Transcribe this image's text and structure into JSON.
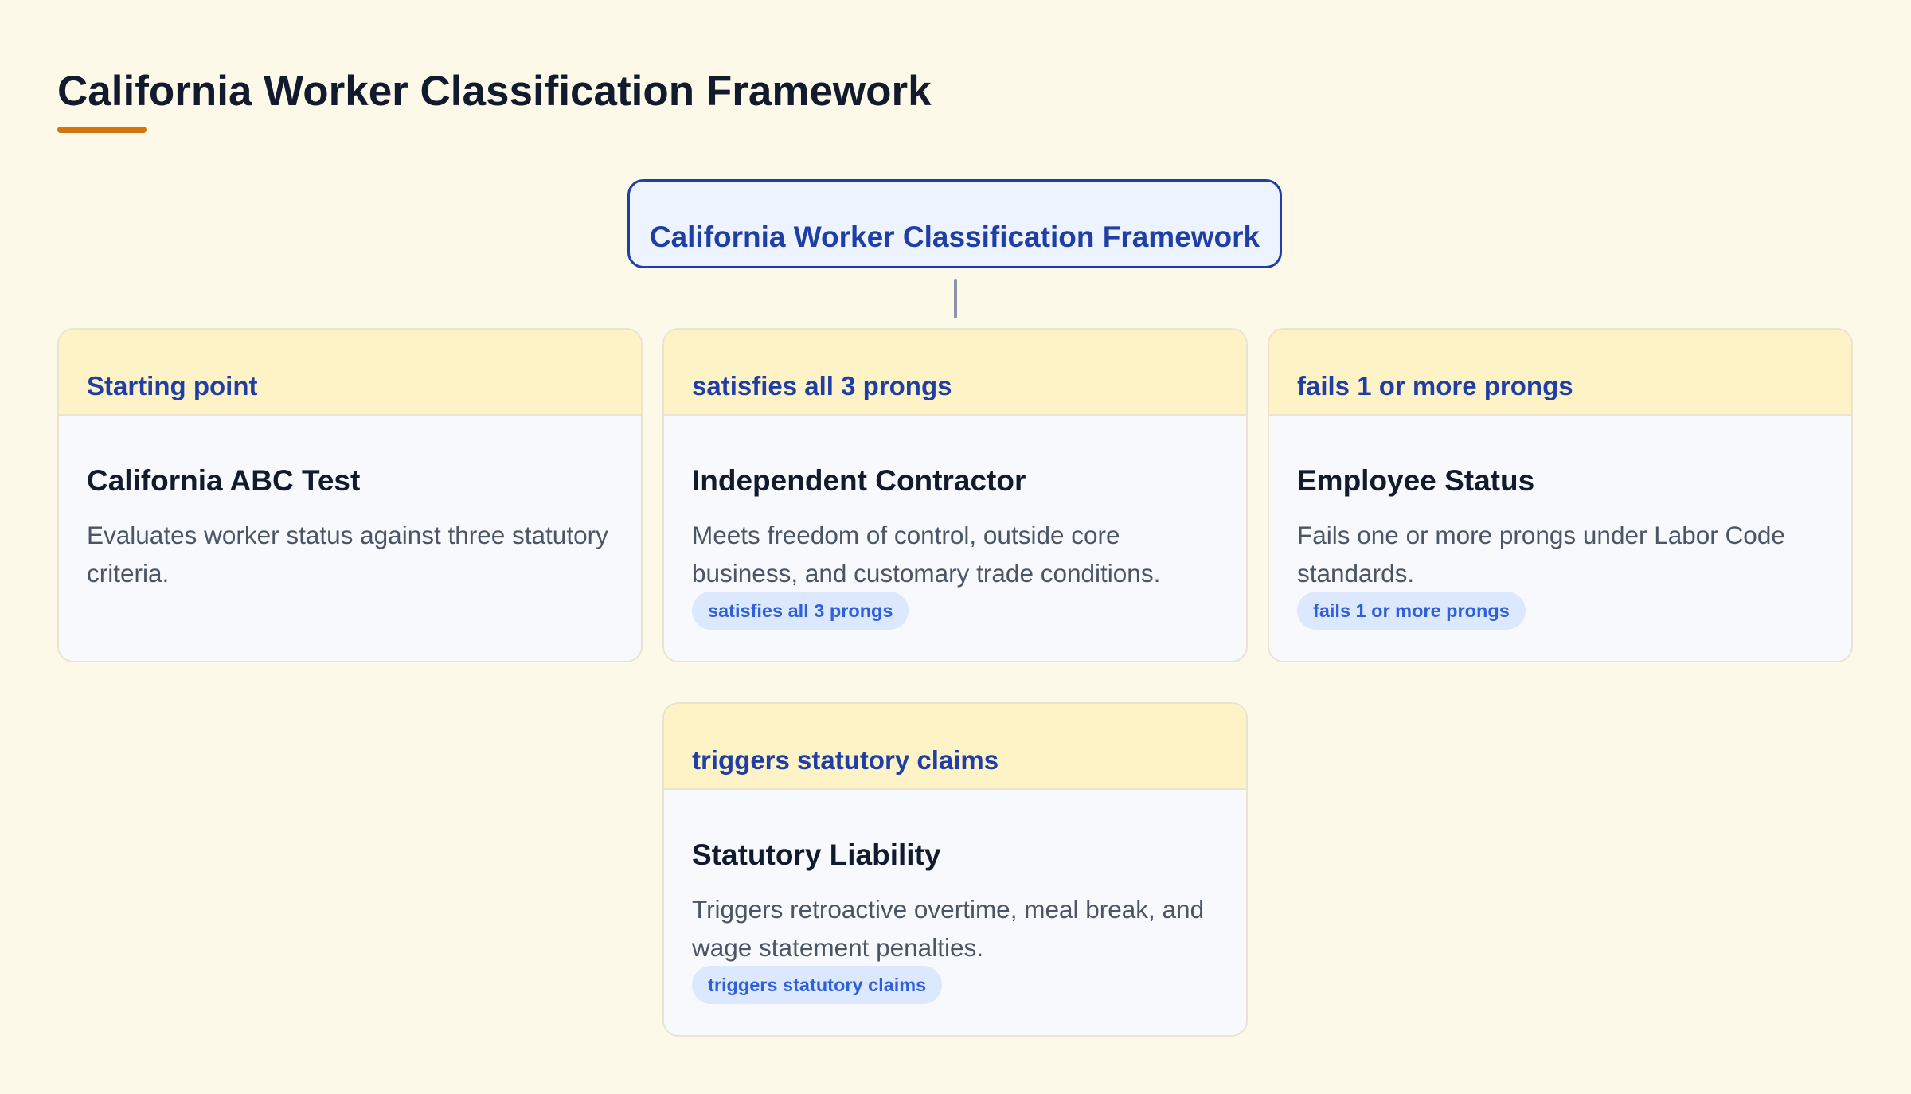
{
  "page": {
    "title": "California Worker Classification Framework"
  },
  "diagram": {
    "root": {
      "label": "California Worker Classification Framework"
    },
    "cards": [
      {
        "header": "Starting point",
        "title": "California ABC Test",
        "description": "Evaluates worker status against three statutory criteria.",
        "badge": ""
      },
      {
        "header": "satisfies all 3 prongs",
        "title": "Independent Contractor",
        "description": "Meets freedom of control, outside core business, and customary trade conditions.",
        "badge": "satisfies all 3 prongs"
      },
      {
        "header": "fails 1 or more prongs",
        "title": "Employee Status",
        "description": "Fails one or more prongs under Labor Code standards.",
        "badge": "fails 1 or more prongs"
      },
      {
        "header": "triggers statutory claims",
        "title": "Statutory Liability",
        "description": "Triggers retroactive overtime, meal break, and wage statement penalties.",
        "badge": "triggers statutory claims"
      }
    ]
  },
  "colors": {
    "background": "#fdf9e8",
    "accent_underline": "#d3740c",
    "primary_blue": "#1f3fa6",
    "card_header_bg": "#fef3c6",
    "card_body_bg": "#f7f9fc",
    "badge_bg": "#dbe8fd",
    "badge_text": "#2f60dc"
  }
}
